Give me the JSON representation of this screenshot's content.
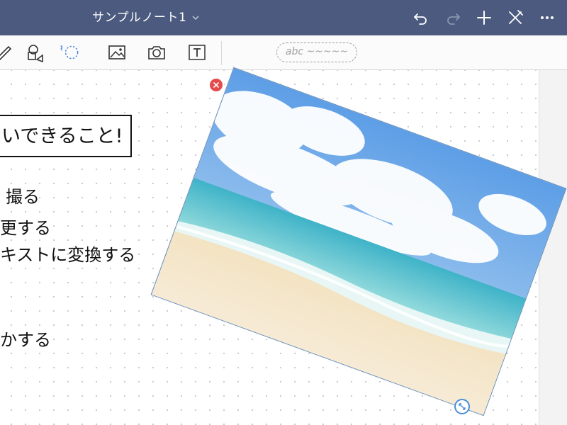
{
  "header": {
    "title": "サンプルノート1",
    "icons": [
      "chevron-down-icon",
      "undo-icon",
      "redo-icon",
      "add-icon",
      "close-pens-icon",
      "more-icon"
    ]
  },
  "toolbar": {
    "tools": [
      "pen-icon",
      "shapes-icon",
      "lasso-icon",
      "image-icon",
      "camera-icon",
      "text-box-icon"
    ],
    "pen_preview": "abc ~~~~~"
  },
  "canvas": {
    "heading": "いできること!",
    "lines": [
      "撮る",
      "更する",
      "キストに変換する",
      "かする"
    ]
  },
  "colors": {
    "header_bg": "#4b5a7e",
    "accent_blue": "#3d7fd6",
    "close_red": "#e54b4b"
  }
}
